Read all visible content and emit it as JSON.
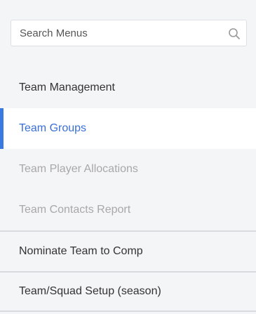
{
  "search": {
    "placeholder": "Search Menus",
    "icon": "search-icon"
  },
  "menu": {
    "items": [
      {
        "label": "Team Management",
        "state": "normal"
      },
      {
        "label": "Team Groups",
        "state": "active"
      },
      {
        "label": "Team Player Allocations",
        "state": "disabled"
      },
      {
        "label": "Team Contacts Report",
        "state": "disabled"
      },
      {
        "label": "Nominate Team to Comp",
        "state": "normal"
      },
      {
        "label": "Team/Squad Setup (season)",
        "state": "normal"
      }
    ]
  },
  "colors": {
    "active_text": "#3a6fd8",
    "active_indicator": "#3a7ae0",
    "disabled_text": "#a8a8a8",
    "background": "#f4f5f7"
  }
}
